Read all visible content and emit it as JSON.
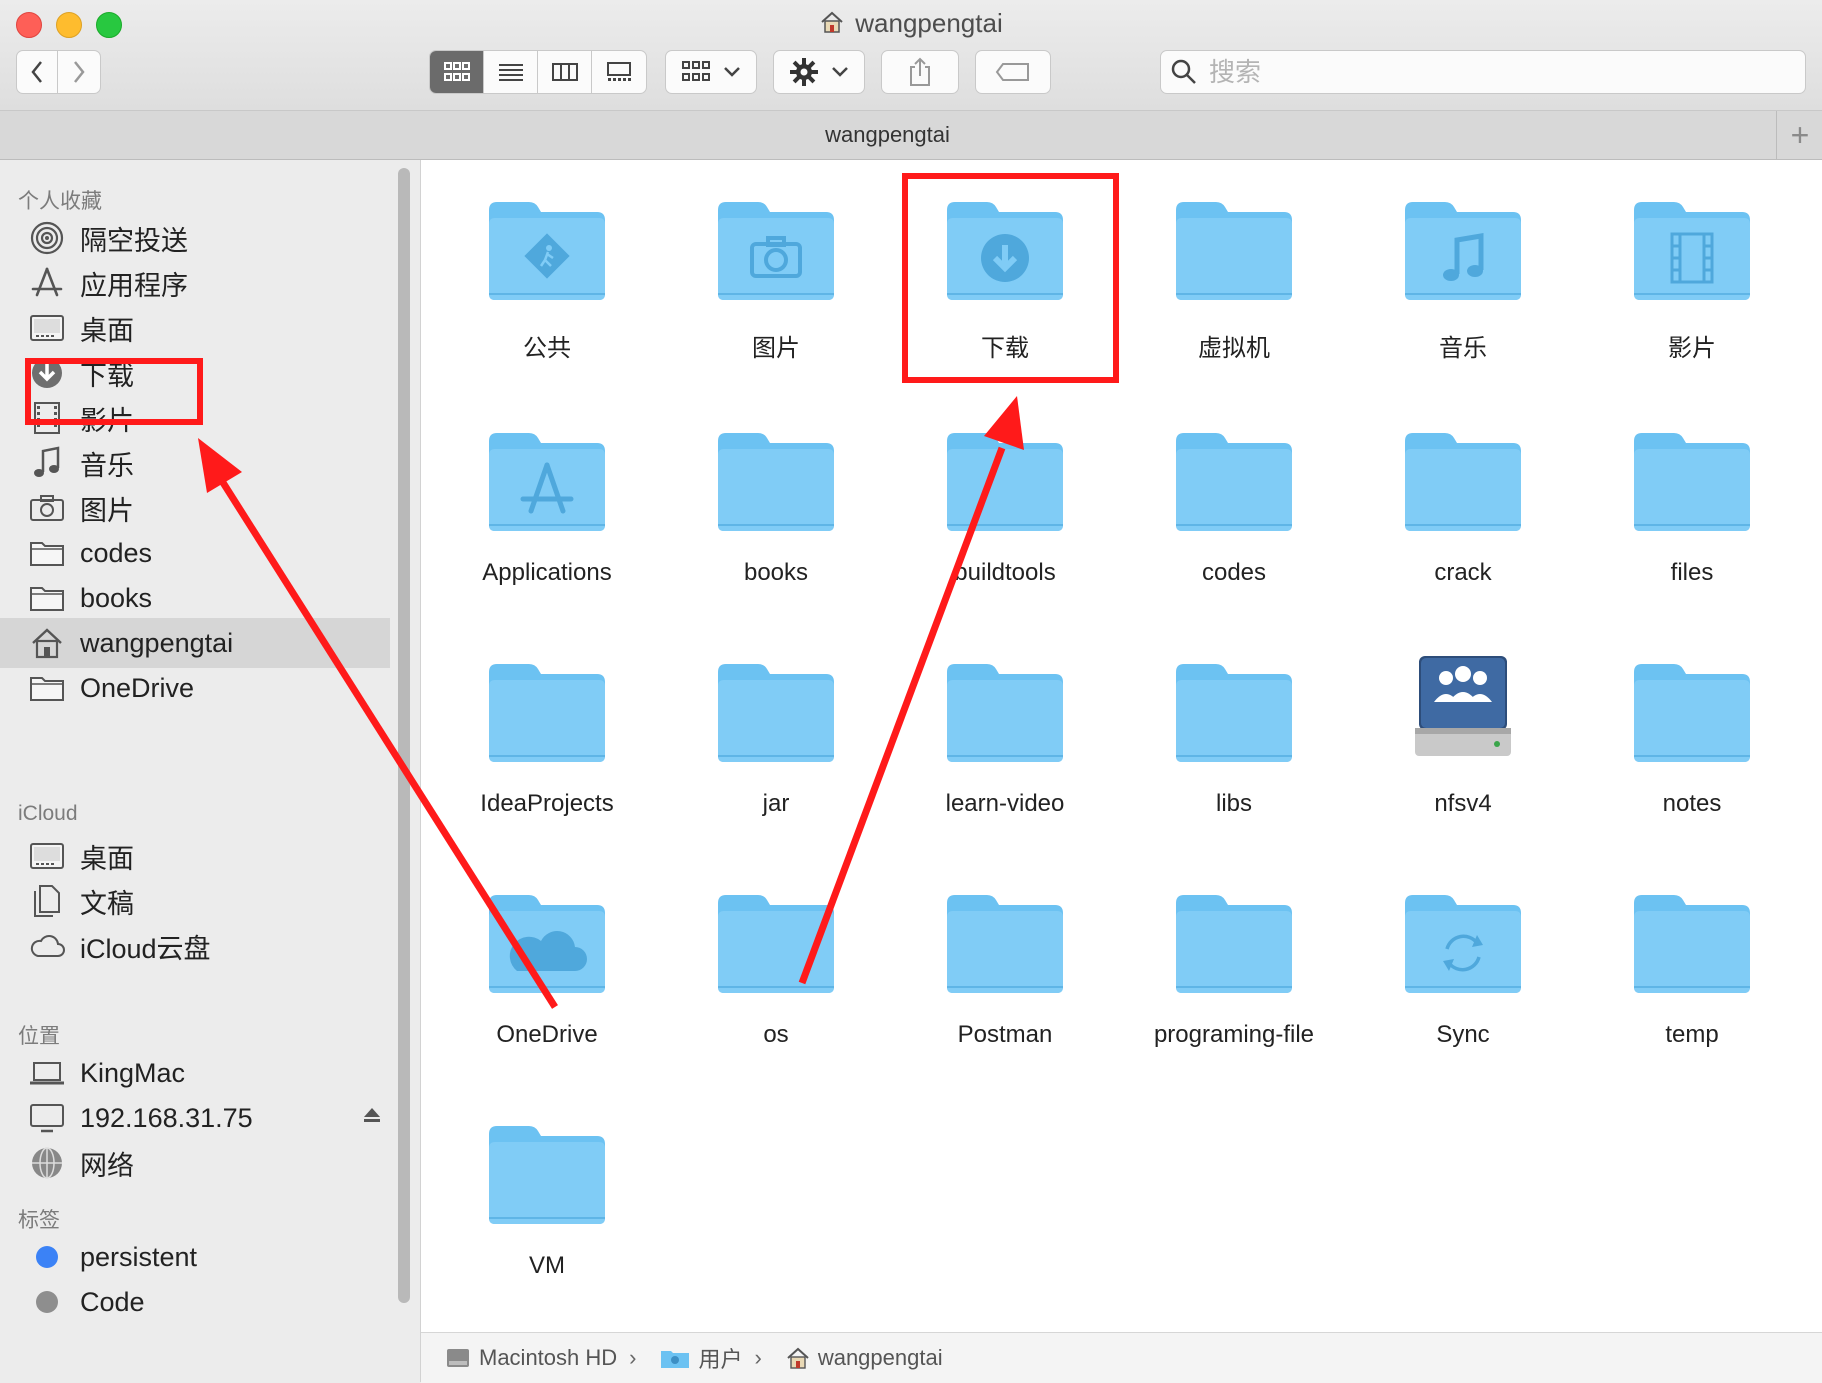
{
  "window": {
    "title": "wangpengtai"
  },
  "toolbar": {
    "back_icon": "chevron-left-icon",
    "forward_icon": "chevron-right-icon",
    "view_modes": [
      "icon-view-icon",
      "list-view-icon",
      "column-view-icon",
      "gallery-view-icon"
    ],
    "group_icon": "grid-group-icon",
    "action_icon": "gear-icon",
    "share_icon": "share-icon",
    "tag_icon": "tag-icon",
    "search_placeholder": "搜索"
  },
  "tabbar": {
    "tab_label": "wangpengtai",
    "add_label": "+"
  },
  "sidebar": {
    "favorites_heading": "个人收藏",
    "favorites": [
      {
        "label": "隔空投送",
        "icon": "airdrop-icon"
      },
      {
        "label": "应用程序",
        "icon": "applications-icon"
      },
      {
        "label": "桌面",
        "icon": "desktop-icon"
      },
      {
        "label": "下载",
        "icon": "download-icon"
      },
      {
        "label": "影片",
        "icon": "movies-icon"
      },
      {
        "label": "音乐",
        "icon": "music-icon"
      },
      {
        "label": "图片",
        "icon": "camera-icon"
      },
      {
        "label": "codes",
        "icon": "folder-icon"
      },
      {
        "label": "books",
        "icon": "folder-icon"
      },
      {
        "label": "wangpengtai",
        "icon": "home-icon"
      },
      {
        "label": "OneDrive",
        "icon": "folder-icon"
      }
    ],
    "icloud_heading": "iCloud",
    "icloud": [
      {
        "label": "桌面",
        "icon": "desktop-icon"
      },
      {
        "label": "文稿",
        "icon": "documents-icon"
      },
      {
        "label": "iCloud云盘",
        "icon": "cloud-icon"
      }
    ],
    "locations_heading": "位置",
    "locations": [
      {
        "label": "KingMac",
        "icon": "laptop-icon"
      },
      {
        "label": "192.168.31.75",
        "icon": "display-icon"
      },
      {
        "label": "网络",
        "icon": "network-icon"
      }
    ],
    "tags_heading": "标签",
    "tags": [
      {
        "label": "persistent",
        "color": "#3b82f6"
      },
      {
        "label": "Code",
        "color": "#8e8e8e"
      }
    ]
  },
  "files": [
    {
      "name": "公共",
      "glyph": "public"
    },
    {
      "name": "图片",
      "glyph": "camera"
    },
    {
      "name": "下载",
      "glyph": "download"
    },
    {
      "name": "虚拟机",
      "glyph": ""
    },
    {
      "name": "音乐",
      "glyph": "music"
    },
    {
      "name": "影片",
      "glyph": "film"
    },
    {
      "name": "Applications",
      "glyph": "apps"
    },
    {
      "name": "books",
      "glyph": ""
    },
    {
      "name": "buildtools",
      "glyph": ""
    },
    {
      "name": "codes",
      "glyph": ""
    },
    {
      "name": "crack",
      "glyph": ""
    },
    {
      "name": "files",
      "glyph": ""
    },
    {
      "name": "IdeaProjects",
      "glyph": ""
    },
    {
      "name": "jar",
      "glyph": ""
    },
    {
      "name": "learn-video",
      "glyph": ""
    },
    {
      "name": "libs",
      "glyph": ""
    },
    {
      "name": "nfsv4",
      "glyph": "server"
    },
    {
      "name": "notes",
      "glyph": ""
    },
    {
      "name": "OneDrive",
      "glyph": "cloud"
    },
    {
      "name": "os",
      "glyph": ""
    },
    {
      "name": "Postman",
      "glyph": ""
    },
    {
      "name": "programing-file",
      "glyph": ""
    },
    {
      "name": "Sync",
      "glyph": "sync"
    },
    {
      "name": "temp",
      "glyph": ""
    },
    {
      "name": "VM",
      "glyph": ""
    }
  ],
  "pathbar": [
    {
      "label": "Macintosh HD",
      "icon": "harddrive-icon"
    },
    {
      "label": "用户",
      "icon": "users-folder-icon"
    },
    {
      "label": "wangpengtai",
      "icon": "home-icon"
    }
  ],
  "pathbar_separator": "›",
  "colors": {
    "folder_top": "#6cc2f2",
    "folder_body": "#80ccf6",
    "folder_glyph": "#4fa8dc",
    "annotation_red": "#ff1a1a"
  }
}
